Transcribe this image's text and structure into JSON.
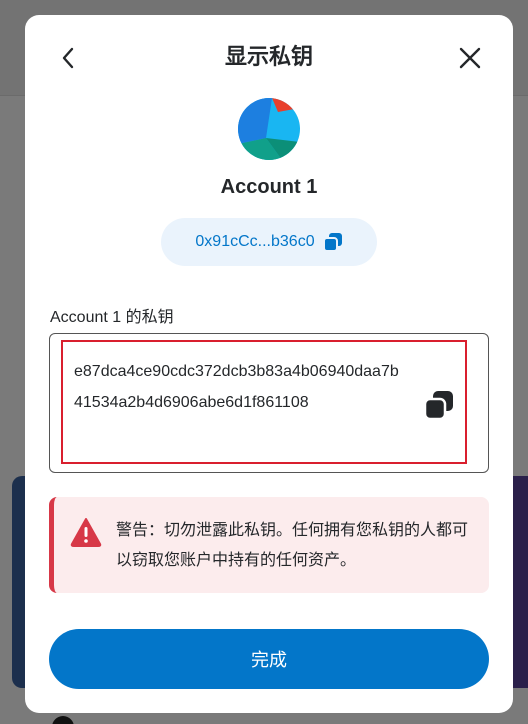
{
  "dialog": {
    "title": "显示私钥",
    "back_icon": "chevron-left-icon",
    "close_icon": "close-icon"
  },
  "account": {
    "name": "Account 1",
    "address_short": "0x91cCc...b36c0",
    "copy_icon": "copy-icon"
  },
  "private_key": {
    "label": "Account 1 的私钥",
    "value": "e87dca4ce90cdc372dcb3b83a4b06940daa7b41534a2b4d6906abe6d1f861108",
    "copy_icon": "copy-icon"
  },
  "warning": {
    "icon": "alert-triangle-icon",
    "text": "警告：切勿泄露此私钥。任何拥有您私钥的人都可以窃取您账户中持有的任何资产。"
  },
  "actions": {
    "done_label": "完成"
  },
  "colors": {
    "primary": "#0376c9",
    "danger": "#d73847",
    "highlight_border": "#d91f2e",
    "warning_bg": "#fceced"
  }
}
